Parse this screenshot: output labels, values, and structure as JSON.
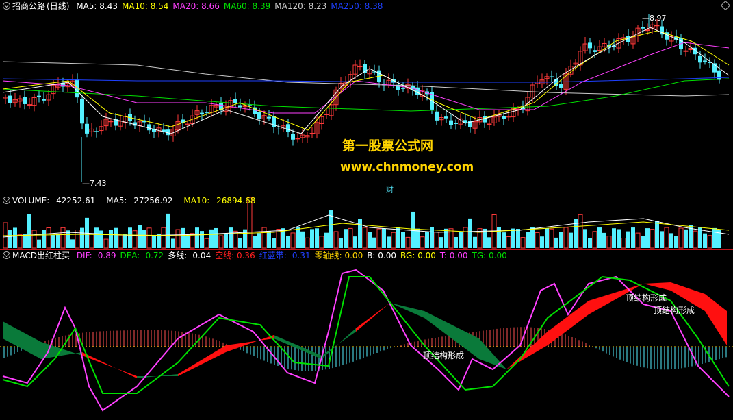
{
  "price": {
    "stock_name": "招商公路",
    "period": "(日线)",
    "ma": [
      {
        "label": "MA5:",
        "value": "8.43",
        "color": "#ffffff"
      },
      {
        "label": "MA10:",
        "value": "8.54",
        "color": "#ffff00"
      },
      {
        "label": "MA20:",
        "value": "8.66",
        "color": "#ff40ff"
      },
      {
        "label": "MA60:",
        "value": "8.39",
        "color": "#00e000"
      },
      {
        "label": "MA120:",
        "value": "8.23",
        "color": "#cccccc"
      },
      {
        "label": "MA250:",
        "value": "8.38",
        "color": "#1e40ff"
      }
    ],
    "high_label": "8.97",
    "low_label": "7.43",
    "finance_marker": "财",
    "watermark_title": "第一股票公式网",
    "watermark_url": "www.chnmoney.com"
  },
  "volume": {
    "label": "VOLUME:",
    "value": "42252.61",
    "ma5_label": "MA5:",
    "ma5_value": "27256.92",
    "ma10_label": "MA10:",
    "ma10_value": "26894.68"
  },
  "macd": {
    "name": "MACD出红柱买",
    "items": [
      {
        "label": "DIF:",
        "value": "-0.89",
        "color": "#ff40ff"
      },
      {
        "label": "DEA:",
        "value": "-0.72",
        "color": "#00e000"
      },
      {
        "label": "多线:",
        "value": "-0.04",
        "color": "#ffffff"
      },
      {
        "label": "空线:",
        "value": "0.36",
        "color": "#ff2020"
      },
      {
        "label": "红蓝带:",
        "value": "-0.31",
        "color": "#2040ff"
      },
      {
        "label": "零轴线:",
        "value": "0.00",
        "color": "#ffd400"
      },
      {
        "label": "B:",
        "value": "0.00",
        "color": "#ffffff"
      },
      {
        "label": "BG:",
        "value": "0.00",
        "color": "#ffff00"
      },
      {
        "label": "T:",
        "value": "0.00",
        "color": "#ff40ff"
      },
      {
        "label": "TG:",
        "value": "0.00",
        "color": "#00e000"
      }
    ],
    "annotations": [
      "顶结构形成",
      "顶结构形成",
      "顶结构形成"
    ]
  }
}
